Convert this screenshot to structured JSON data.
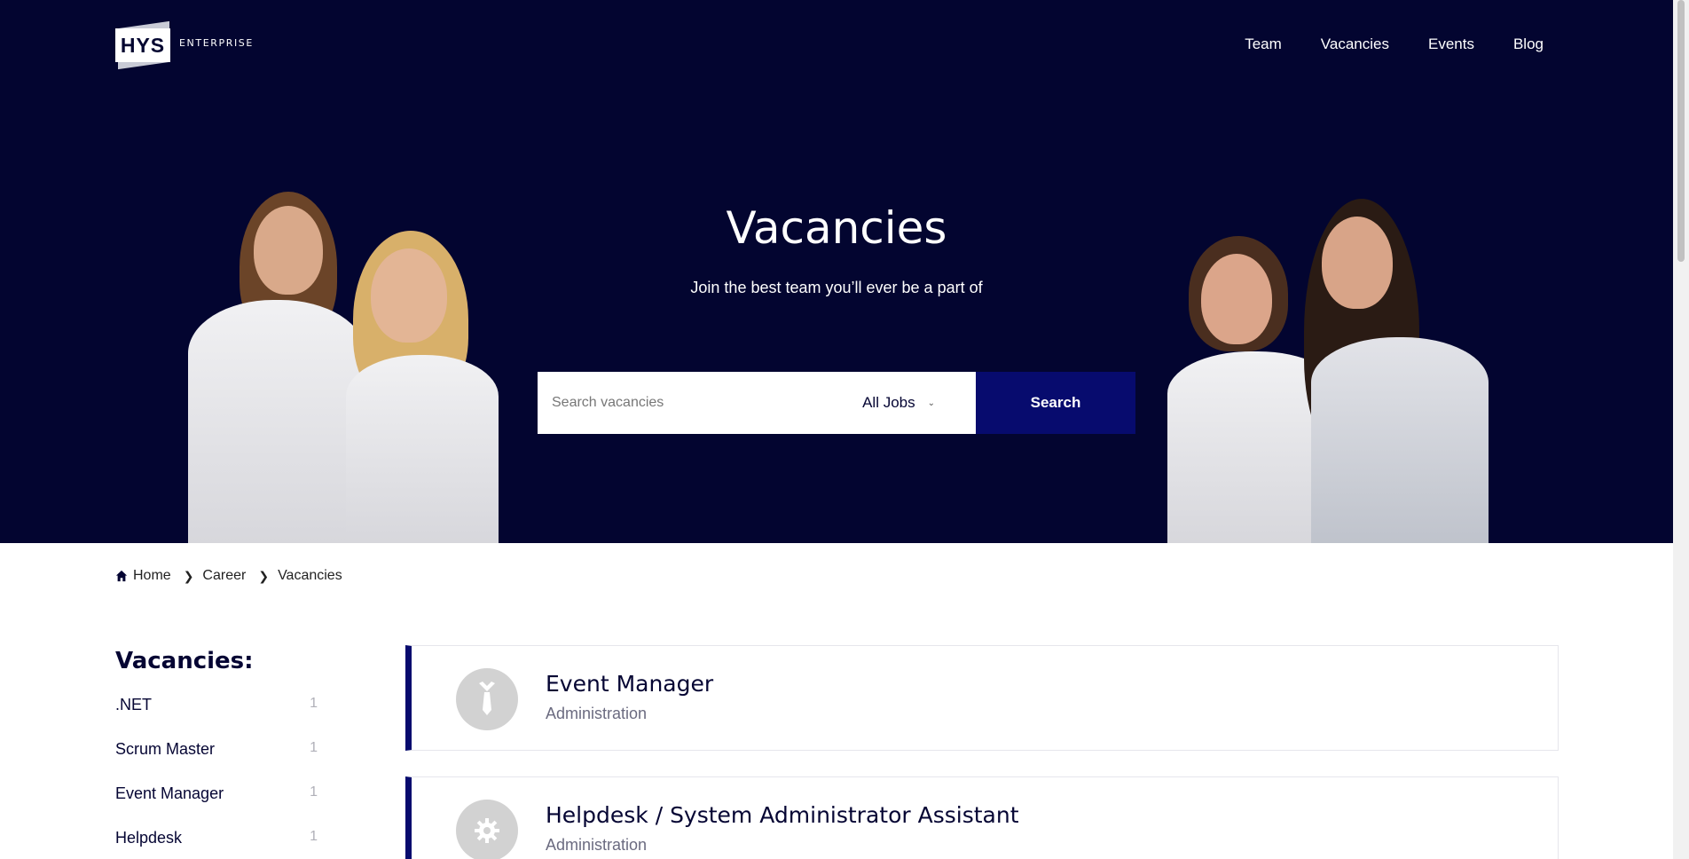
{
  "header": {
    "logo_main": "HYS",
    "logo_sub": "ENTERPRISE",
    "nav": [
      {
        "label": "Team"
      },
      {
        "label": "Vacancies"
      },
      {
        "label": "Events"
      },
      {
        "label": "Blog"
      }
    ]
  },
  "hero": {
    "title": "Vacancies",
    "subtitle": "Join the best team you’ll ever be a part of",
    "search": {
      "placeholder": "Search vacancies",
      "value": "",
      "category_selected": "All Jobs",
      "button_label": "Search"
    }
  },
  "breadcrumb": {
    "items": [
      "Home",
      "Career",
      "Vacancies"
    ]
  },
  "sidebar": {
    "title": "Vacancies:",
    "items": [
      {
        "label": ".NET",
        "count": "1"
      },
      {
        "label": "Scrum Master",
        "count": "1"
      },
      {
        "label": "Event Manager",
        "count": "1"
      },
      {
        "label": "Helpdesk",
        "count": "1"
      }
    ]
  },
  "vacancies": [
    {
      "title": "Event Manager",
      "category": "Administration",
      "icon": "tie-icon"
    },
    {
      "title": "Helpdesk / System Administrator Assistant",
      "category": "Administration",
      "icon": "gear-icon"
    }
  ],
  "colors": {
    "hero_bg": "#030530",
    "accent": "#070b6e",
    "text_dark": "#050533",
    "icon_circle": "#d2d2d2"
  }
}
